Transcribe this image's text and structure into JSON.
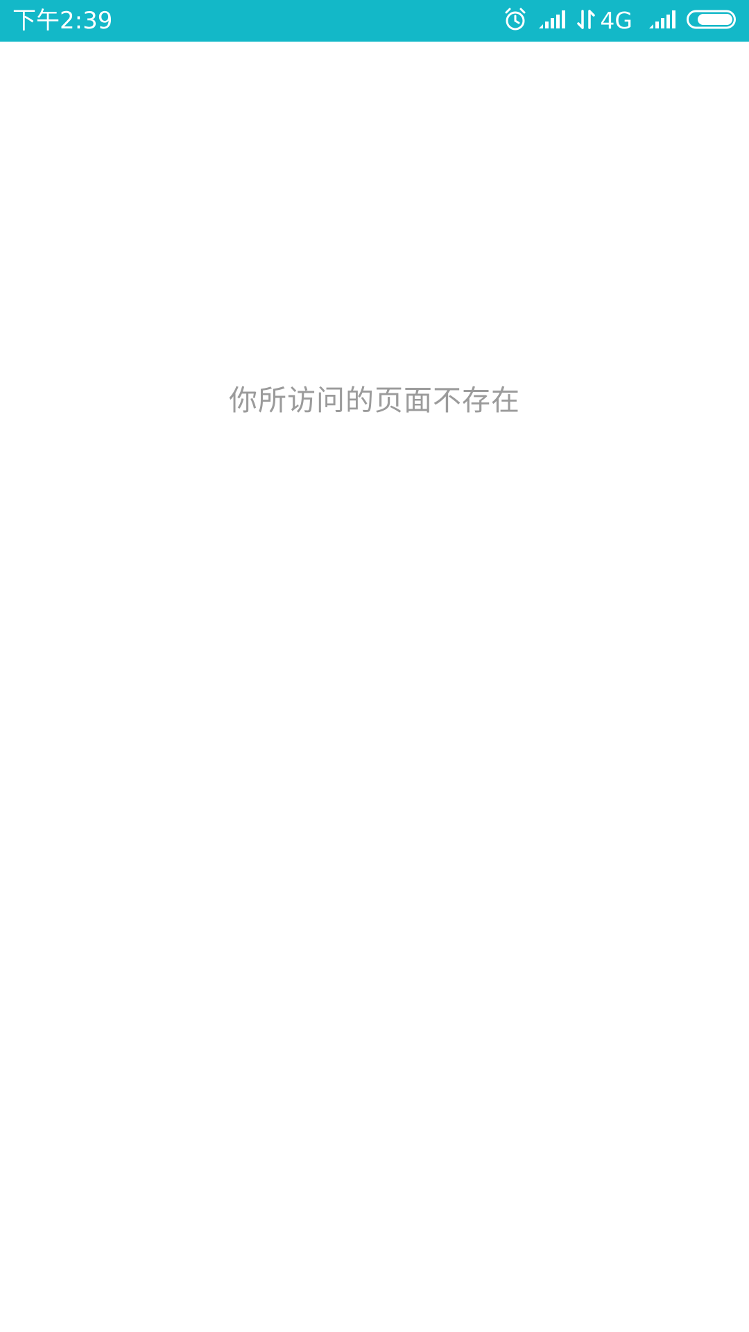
{
  "status_bar": {
    "time": "下午2:39",
    "network_type": "4G",
    "bg_color": "#13b8c8",
    "icons": [
      "alarm-icon",
      "signal-icon",
      "data-arrows-icon",
      "signal-icon",
      "battery-icon"
    ]
  },
  "main": {
    "message": "你所访问的页面不存在"
  }
}
